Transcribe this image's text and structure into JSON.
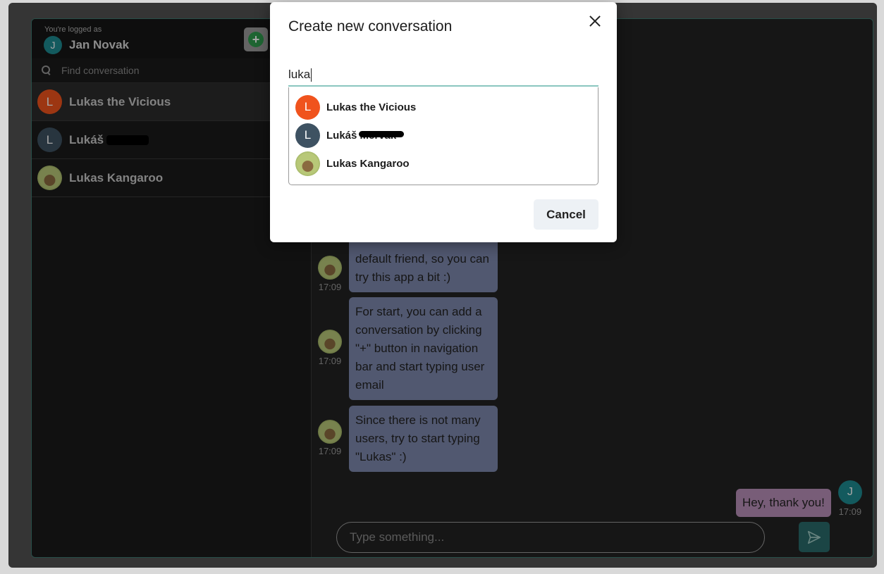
{
  "colors": {
    "accent": "#2a6b6a",
    "orange": "#f0531d",
    "slate": "#3e5262",
    "teal": "#1e8a91"
  },
  "header": {
    "logged_label": "You're logged as",
    "user_initial": "J",
    "user_name": "Jan Novak"
  },
  "search": {
    "placeholder": "Find conversation"
  },
  "conversations": [
    {
      "initial": "L",
      "name": "Lukas the Vicious",
      "avatar": "orange"
    },
    {
      "initial": "L",
      "name": "Lukáš",
      "avatar": "slate",
      "redacted": true
    },
    {
      "initial": "",
      "name": "Lukas Kangaroo",
      "avatar": "kangaroo-photo"
    }
  ],
  "messages": [
    {
      "from": "Lukas Kangaroo",
      "time": "17:09",
      "text": "default friend, so you can try this app a bit :)"
    },
    {
      "from": "Lukas Kangaroo",
      "time": "17:09",
      "text": "For start, you can add a conversation by clicking \"+\" button in navigation bar and start typing user email"
    },
    {
      "from": "Lukas Kangaroo",
      "time": "17:09",
      "text": "Since there is not many users, try to start typing \"Lukas\" :)"
    },
    {
      "from": "Jan Novak",
      "initial": "J",
      "time": "17:09",
      "text": "Hey, thank you!"
    }
  ],
  "composer": {
    "placeholder": "Type something..."
  },
  "modal": {
    "title": "Create new conversation",
    "input_value": "luka",
    "results": [
      {
        "initial": "L",
        "name": "Lukas the Vicious",
        "avatar": "orange"
      },
      {
        "initial": "L",
        "name": "Lukáš Mervak",
        "avatar": "slate",
        "redacted": true
      },
      {
        "initial": "",
        "name": "Lukas Kangaroo",
        "avatar": "kangaroo-photo"
      }
    ],
    "cancel_label": "Cancel"
  }
}
